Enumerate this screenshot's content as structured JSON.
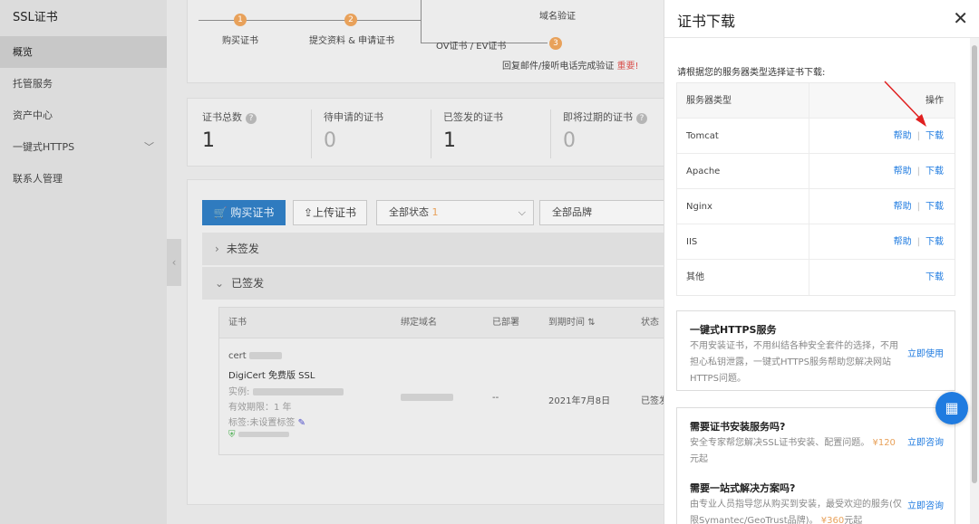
{
  "sidebar": {
    "title": "SSL证书",
    "items": [
      {
        "label": "概览",
        "active": true
      },
      {
        "label": "托管服务"
      },
      {
        "label": "资产中心"
      },
      {
        "label": "一键式HTTPS"
      },
      {
        "label": "联系人管理"
      }
    ]
  },
  "steps": {
    "s1": {
      "num": "1",
      "label": "购买证书"
    },
    "s2": {
      "num": "2",
      "label": "提交资料 & 申请证书"
    },
    "domain_verify": "域名验证",
    "ov_ev": "OV证书 / EV证书",
    "s3": {
      "num": "3",
      "label": "回复邮件/接听电话完成验证",
      "urgent": "重要!"
    }
  },
  "stats": [
    {
      "label": "证书总数",
      "value": "1",
      "help": "?"
    },
    {
      "label": "待申请的证书",
      "value": "0"
    },
    {
      "label": "已签发的证书",
      "value": "1"
    },
    {
      "label": "即将过期的证书",
      "value": "0",
      "help": "?"
    }
  ],
  "toolbar": {
    "buy_label": "购买证书",
    "upload_label": "上传证书",
    "status_filter": "全部状态",
    "status_count": "1",
    "brand_filter": "全部品牌"
  },
  "groups": {
    "unissued": "未签发",
    "issued": "已签发"
  },
  "table": {
    "headers": [
      "证书",
      "绑定域名",
      "已部署",
      "到期时间",
      "状态"
    ],
    "row": {
      "cert_prefix": "cert",
      "cert_type": "DigiCert 免费版 SSL",
      "instance_label": "实例:",
      "validity": "有效期限：1 年",
      "tag": "标签:未设置标签",
      "deployed": "--",
      "expiry": "2021年7月8日",
      "status": "已签发"
    }
  },
  "drawer": {
    "title": "证书下载",
    "intro": "请根据您的服务器类型选择证书下载:",
    "header_type": "服务器类型",
    "header_action": "操作",
    "help_label": "帮助",
    "download_label": "下载",
    "servers": [
      {
        "name": "Tomcat",
        "help": true
      },
      {
        "name": "Apache",
        "help": true
      },
      {
        "name": "Nginx",
        "help": true
      },
      {
        "name": "IIS",
        "help": true
      },
      {
        "name": "其他",
        "help": false
      }
    ],
    "https_box": {
      "title": "一键式HTTPS服务",
      "desc": "不用安装证书，不用纠结各种安全套件的选择，不用担心私钥泄露，一键式HTTPS服务帮助您解决网站HTTPS问题。",
      "action": "立即使用"
    },
    "install_box": {
      "title": "需要证书安装服务吗?",
      "desc": "安全专家帮您解决SSL证书安装、配置问题。",
      "price": "¥120",
      "unit": "元起",
      "action": "立即咨询"
    },
    "solution_box": {
      "title": "需要一站式解决方案吗?",
      "desc": "由专业人员指导您从购买到安装，最受欢迎的服务(仅限Symantec/GeoTrust品牌)。",
      "price": "¥360",
      "unit": "元起",
      "action": "立即咨询"
    }
  }
}
